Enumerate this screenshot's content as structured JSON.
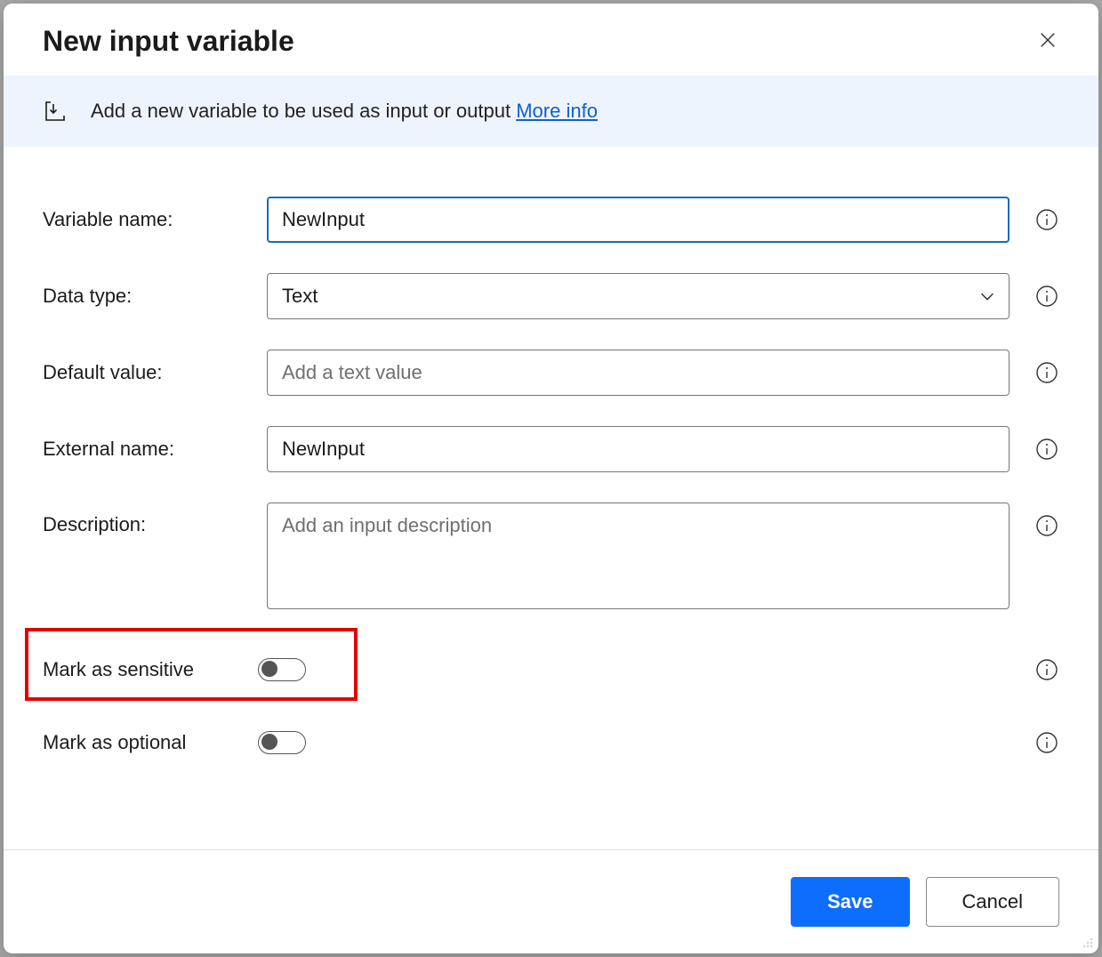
{
  "header": {
    "title": "New input variable"
  },
  "banner": {
    "text": "Add a new variable to be used as input or output ",
    "link_label": "More info"
  },
  "fields": {
    "variable_name": {
      "label": "Variable name:",
      "value": "NewInput"
    },
    "data_type": {
      "label": "Data type:",
      "value": "Text"
    },
    "default_value": {
      "label": "Default value:",
      "placeholder": "Add a text value",
      "value": ""
    },
    "external_name": {
      "label": "External name:",
      "value": "NewInput"
    },
    "description": {
      "label": "Description:",
      "placeholder": "Add an input description",
      "value": ""
    },
    "mark_sensitive": {
      "label": "Mark as sensitive",
      "checked": false
    },
    "mark_optional": {
      "label": "Mark as optional",
      "checked": false
    }
  },
  "footer": {
    "save": "Save",
    "cancel": "Cancel"
  }
}
